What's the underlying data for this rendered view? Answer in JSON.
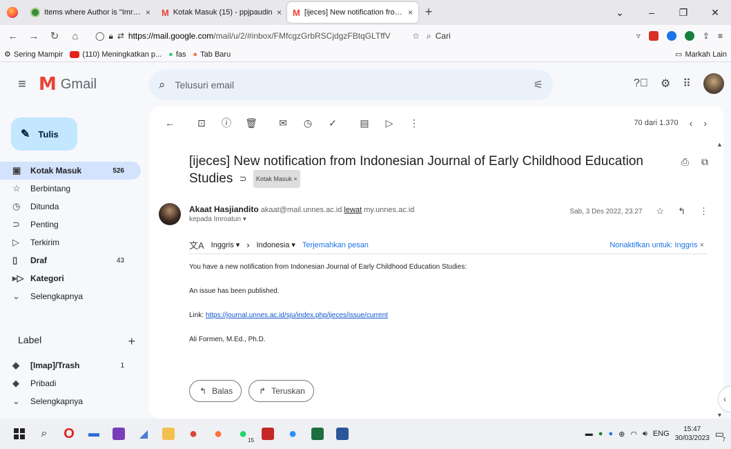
{
  "browser": {
    "tabs": [
      {
        "title": "Items where Author is \"Imroatu",
        "favicon": "green-circle",
        "active": false
      },
      {
        "title": "Kotak Masuk (15) - ppjpaudin",
        "favicon": "gmail",
        "active": false
      },
      {
        "title": "[ijeces] New notification from I",
        "favicon": "gmail",
        "active": true
      }
    ],
    "new_tab": "+",
    "url_host": "https://mail.google.com",
    "url_rest": "/mail/u/2/#inbox/FMfcgzGrbRSCjdgzFBtqGLTffV",
    "search_placeholder": "Cari",
    "bookmarks": [
      {
        "label": "Sering Mampir",
        "icon": "gear-icon"
      },
      {
        "label": "(110) Meningkatkan p...",
        "icon": "youtube-icon"
      },
      {
        "label": "fas",
        "icon": "whatsapp-icon"
      },
      {
        "label": "Tab Baru",
        "icon": "firefox-icon"
      }
    ],
    "other_bookmarks": "Markah Lain"
  },
  "gmail": {
    "logo_text": "Gmail",
    "search_placeholder": "Telusuri email",
    "compose_label": "Tulis",
    "nav": [
      {
        "label": "Kotak Masuk",
        "count": "526",
        "icon": "inbox-icon",
        "active": true,
        "bold": true
      },
      {
        "label": "Berbintang",
        "count": "",
        "icon": "star-icon"
      },
      {
        "label": "Ditunda",
        "count": "",
        "icon": "clock-icon"
      },
      {
        "label": "Penting",
        "count": "",
        "icon": "important-icon"
      },
      {
        "label": "Terkirim",
        "count": "",
        "icon": "send-icon"
      },
      {
        "label": "Draf",
        "count": "43",
        "icon": "draft-icon",
        "bold": true
      },
      {
        "label": "Kategori",
        "count": "",
        "icon": "label-outline-icon",
        "bold": true
      },
      {
        "label": "Selengkapnya",
        "count": "",
        "icon": "chevron-down-icon"
      }
    ],
    "labels_heading": "Label",
    "labels_add": "+",
    "labels": [
      {
        "label": "[Imap]/Trash",
        "count": "1",
        "icon": "label-icon",
        "bold": true
      },
      {
        "label": "Pribadi",
        "count": "",
        "icon": "label-icon"
      },
      {
        "label": "Selengkapnya",
        "count": "",
        "icon": "chevron-down-icon"
      }
    ],
    "pager": "70 dari 1.370"
  },
  "email": {
    "subject": "[ijeces] New notification from Indonesian Journal of Early Childhood Education Studies",
    "tag": "Kotak Masuk ×",
    "sender_name": "Akaat Hasjiandito",
    "sender_email": "akaat@mail.unnes.ac.id",
    "via_label": "lewat",
    "via_domain": "my.unnes.ac.id",
    "to_line": "kepada Imroatun ▾",
    "date": "Sab, 3 Des 2022, 23.27",
    "translate": {
      "from_lang": "Inggris",
      "to_lang": "Indonesia",
      "action": "Terjemahkan pesan",
      "disable": "Nonaktifkan untuk: Inggris"
    },
    "body": {
      "line1": "You have a new notification from Indonesian Journal of Early Childhood Education Studies:",
      "line2": "An issue has been published.",
      "link_label": "Link: ",
      "link": "https://journal.unnes.ac.id/sju/index.php/ijeces/issue/current",
      "signature": "Ali Formen, M.Ed., Ph.D."
    },
    "reply_label": "Balas",
    "forward_label": "Teruskan"
  },
  "taskbar": {
    "lang": "ENG",
    "time": "15:47",
    "date": "30/03/2023",
    "notif_count": "7",
    "whatsapp_badge": "15"
  },
  "colors": {
    "accent": "#1a73e8",
    "compose_bg": "#c2e7ff",
    "active_nav": "#d3e3fd",
    "search_bg": "#eaf1fb"
  }
}
